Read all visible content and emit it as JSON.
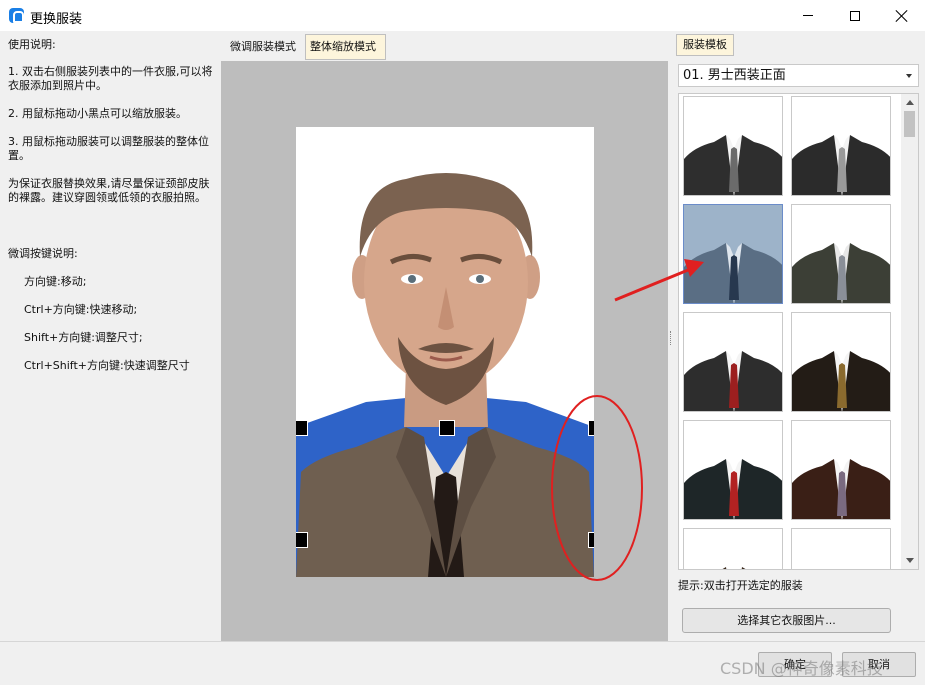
{
  "window": {
    "title": "更换服装"
  },
  "instructions": {
    "heading": "使用说明:",
    "step1": "1. 双击右侧服装列表中的一件衣服,可以将衣服添加到照片中。",
    "step2": "2. 用鼠标拖动小黑点可以缩放服装。",
    "step3": "3. 用鼠标拖动服装可以调整服装的整体位置。",
    "note": "为保证衣服替换效果,请尽量保证颈部皮肤的裸露。建议穿圆领或低领的衣服拍照。",
    "keys_heading": "微调按键说明:",
    "keys": [
      "方向键:移动;",
      "Ctrl+方向键:快速移动;",
      "Shift+方向键:调整尺寸;",
      "Ctrl+Shift+方向键:快速调整尺寸"
    ]
  },
  "center": {
    "tab_fine": "微调服装模式",
    "tab_whole": "整体缩放模式",
    "active_tab": "整体缩放模式"
  },
  "right": {
    "tab": "服装模板",
    "category": "01. 男士西装正面",
    "hint": "提示:双击打开选定的服装",
    "choose_button": "选择其它衣服图片..."
  },
  "thumbnails": [
    {
      "suit": "#2e2e2e",
      "tie": "#6b6b6b",
      "shirt": "#f4f4f4"
    },
    {
      "suit": "#2b2b2b",
      "tie": "#9a9a9a",
      "shirt": "#f4f4f4"
    },
    {
      "suit": "#5a6e84",
      "tie": "#27384f",
      "shirt": "#dfe6ee",
      "selected": true
    },
    {
      "suit": "#3c3f36",
      "tie": "#8a8f98",
      "shirt": "#e8e8e8"
    },
    {
      "suit": "#2d2d2d",
      "tie": "#9c1f1f",
      "shirt": "#f4f4f4"
    },
    {
      "suit": "#231c16",
      "tie": "#8a6a2e",
      "shirt": "#f4f4f4"
    },
    {
      "suit": "#1e2628",
      "tie": "#b22222",
      "shirt": "#f4f4f4"
    },
    {
      "suit": "#3a1f16",
      "tie": "#7a6a80",
      "shirt": "#f4f4f4"
    },
    {
      "suit": "#3a2a1e",
      "tie": "#3a2a1e",
      "shirt": "#f4f4f4"
    },
    {
      "suit": "#ffffff",
      "tie": "#ffffff",
      "shirt": "#ffffff"
    }
  ],
  "bottom": {
    "ok": "确定",
    "cancel": "取消",
    "watermark": "CSDN @神奇像素科技"
  },
  "colors": {
    "annotation": "#e02020",
    "tab_active_bg": "#fdf5dc"
  }
}
